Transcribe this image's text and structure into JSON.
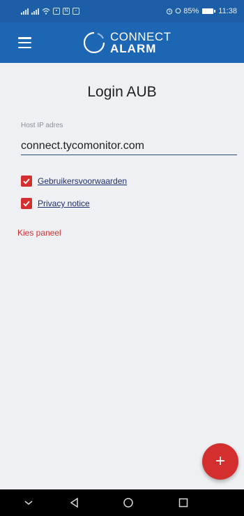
{
  "status_bar": {
    "battery": "85%",
    "time": "11:38"
  },
  "app_bar": {
    "logo_top": "CONNECT",
    "logo_bottom": "ALARM"
  },
  "login": {
    "title": "Login AUB",
    "host_label": "Host IP adres",
    "host_value": "connect.tycomonitor.com",
    "terms_label": "Gebruikersvoorwaarden",
    "terms_checked": true,
    "privacy_label": "Privacy notice",
    "privacy_checked": true,
    "choose_panel": "Kies paneel"
  },
  "fab": {
    "icon": "plus-icon",
    "label": "+"
  },
  "nav_bar": {
    "buttons": [
      "chevron-down-icon",
      "back-triangle-icon",
      "home-circle-icon",
      "recents-square-icon"
    ]
  },
  "colors": {
    "app_bar": "#1c66b3",
    "status_bar": "#1c5fa6",
    "accent_red": "#d32f2f",
    "background": "#eef0f3"
  }
}
